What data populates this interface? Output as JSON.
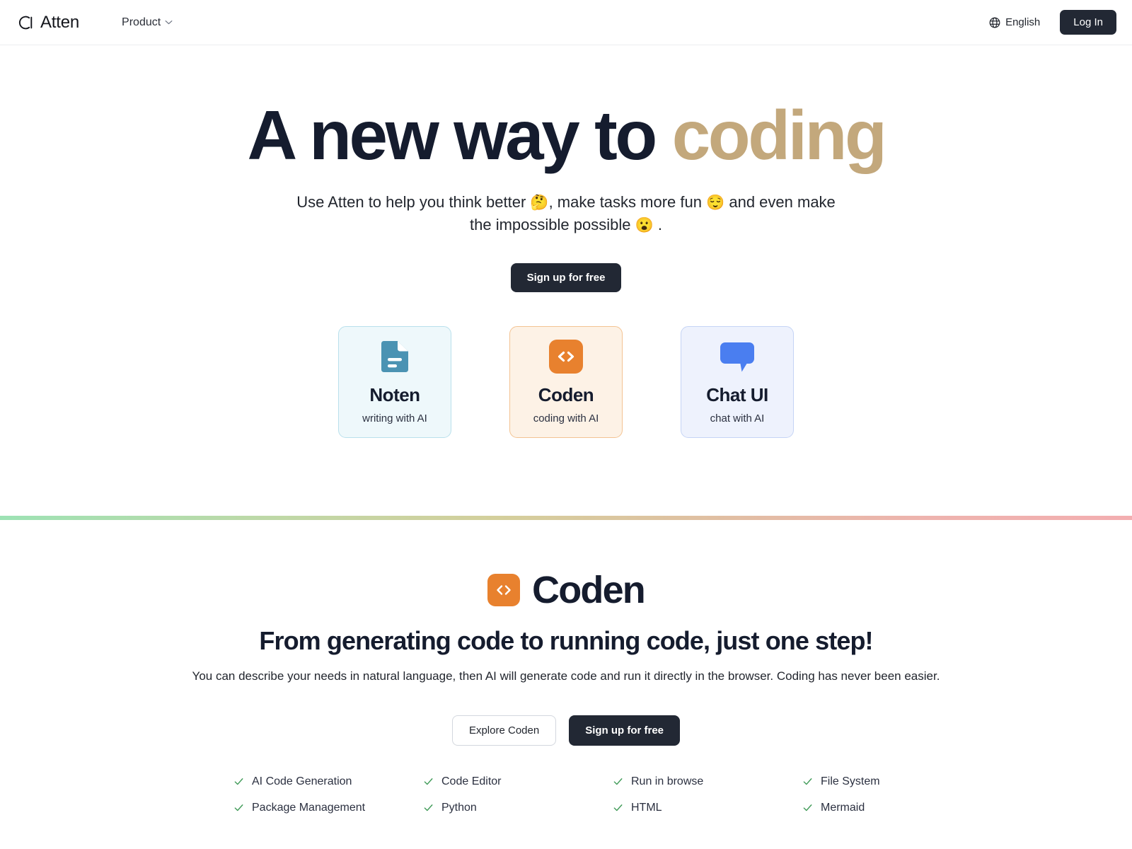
{
  "nav": {
    "brand_name": "Atten",
    "brand_icon": "atten-logo-icon",
    "menu": [
      {
        "label": "Product",
        "icon": "chevron-down-icon"
      }
    ],
    "language": {
      "label": "English",
      "icon": "globe-icon"
    },
    "login_label": "Log In"
  },
  "hero": {
    "headline_lead": "A new way to ",
    "headline_accent": "coding",
    "subhead_line1_a": "Use Atten to help you think better ",
    "subhead_emoji1": "🤔",
    "subhead_line1_b": ", make tasks more fun ",
    "subhead_emoji2": "😌",
    "subhead_line1_c": " and even make",
    "subhead_line2_a": "the impossible possible ",
    "subhead_emoji3": "😮",
    "subhead_line2_b": " .",
    "cta_label": "Sign up for free",
    "cards": [
      {
        "title": "Noten",
        "subtitle": "writing with AI",
        "icon": "document-icon",
        "accent": "#4b93b3",
        "bg": "#eef8fb",
        "border": "#b9e0ec"
      },
      {
        "title": "Coden",
        "subtitle": "coding with AI",
        "icon": "code-brackets-icon",
        "accent": "#e8812e",
        "bg": "#fdf2e6",
        "border": "#f3c392"
      },
      {
        "title": "Chat UI",
        "subtitle": "chat with AI",
        "icon": "chat-bubble-icon",
        "accent": "#4a7ef0",
        "bg": "#eef2fd",
        "border": "#c5d4f5"
      }
    ]
  },
  "divider": {
    "gradient_start": "#9de2b4",
    "gradient_mid": "#d4cf9c",
    "gradient_end": "#f3aeb0"
  },
  "coden_section": {
    "logo_icon": "code-brackets-icon",
    "logo_color": "#e8812e",
    "name": "Coden",
    "headline": "From generating code to running code, just one step!",
    "description": "You can describe your needs in natural language, then AI will generate code and run it directly in the browser. Coding has never been easier.",
    "explore_label": "Explore Coden",
    "signup_label": "Sign up for free",
    "check_color": "#3f9a57",
    "features": [
      "AI Code Generation",
      "Code Editor",
      "Run in browse",
      "File System",
      "Package Management",
      "Python",
      "HTML",
      "Mermaid"
    ]
  },
  "theme": {
    "headline_dark": "#151c2e",
    "headline_accent": "#c3a87c",
    "button_dark": "#222834"
  }
}
